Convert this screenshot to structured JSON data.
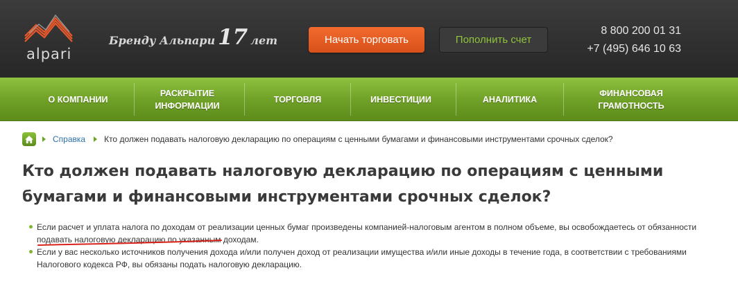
{
  "header": {
    "logo_text": "alpari",
    "slogan_prefix": "Бренду Альпари",
    "slogan_years": "17",
    "slogan_suffix": "лет",
    "start_trading_label": "Начать торговать",
    "deposit_label": "Пополнить счет",
    "phone_1": "8 800 200 01 31",
    "phone_2": "+7 (495) 646 10 63",
    "colors": {
      "accent_orange": "#e85e22",
      "accent_green": "#8fc43b",
      "bar_dark": "#333333"
    }
  },
  "nav": {
    "items": [
      {
        "label": "О КОМПАНИИ"
      },
      {
        "label": "РАСКРЫТИЕ ИНФОРМАЦИИ"
      },
      {
        "label": "ТОРГОВЛЯ"
      },
      {
        "label": "ИНВЕСТИЦИИ"
      },
      {
        "label": "АНАЛИТИКА"
      },
      {
        "label": "ФИНАНСОВАЯ ГРАМОТНОСТЬ"
      }
    ]
  },
  "breadcrumb": {
    "home_icon": "home-icon",
    "link": "Справка",
    "current": "Кто должен подавать налоговую декларацию по операциям с ценными бумагами и финансовыми инструментами срочных сделок?"
  },
  "article": {
    "title": "Кто должен подавать налоговую декларацию по операциям с ценными бумагами и финансовыми инструментами срочных сделок?",
    "bullets": [
      "Если расчет и уплата налога по доходам от реализации ценных бумаг произведены компанией-налоговым агентом в полном объеме, вы освобождаетесь от обязанности подавать налоговую декларацию по указанным доходам.",
      "Если у вас несколько источников получения дохода и/или получен доход от реализации имущества и/или иные доходы в течение года, в соответствии с требованиями Налогового кодекса РФ, вы обязаны подать налоговую декларацию."
    ]
  }
}
